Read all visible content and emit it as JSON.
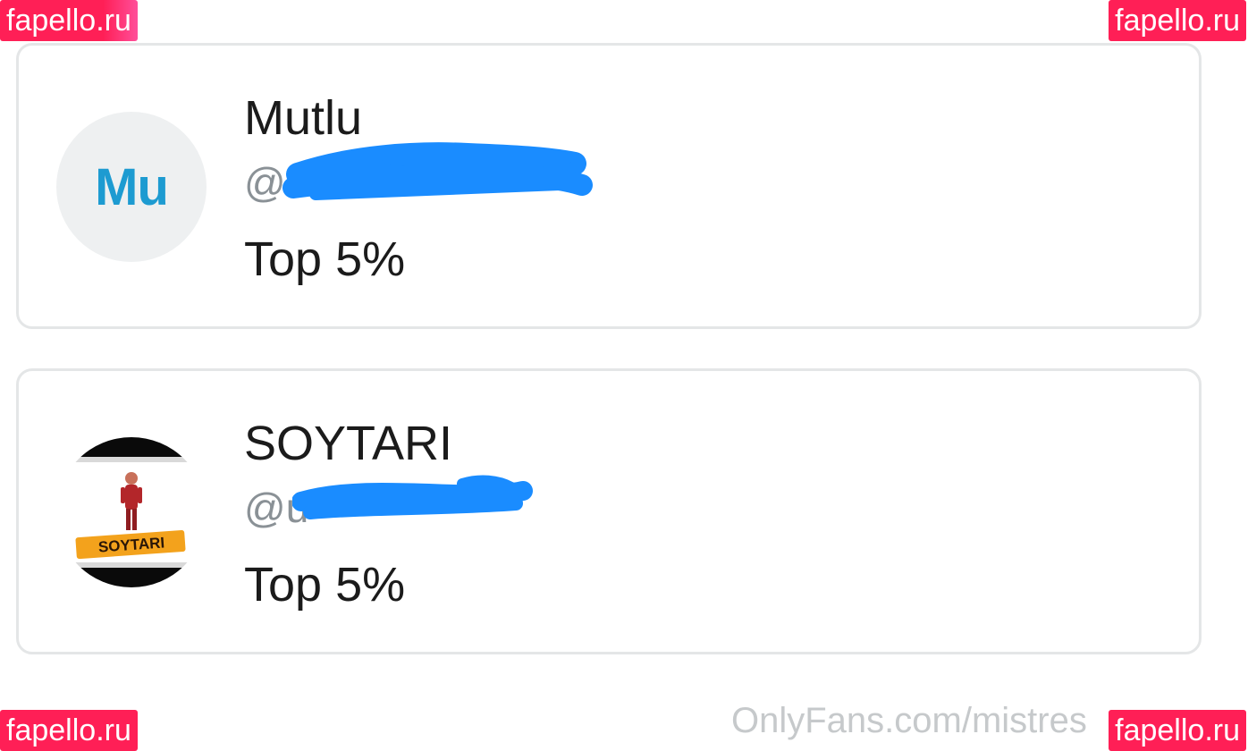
{
  "watermarks": {
    "top_left": "fapello.ru",
    "top_right": "fapello.ru",
    "bottom_left": "fapello.ru",
    "bottom_right": "fapello.ru",
    "footer": "OnlyFans.com/mistres"
  },
  "fans": [
    {
      "name": "Mutlu",
      "handle": "@",
      "rank": "Top 5%",
      "avatar_initials": "Mu",
      "avatar_color": "#1d9bd1"
    },
    {
      "name": "SOYTARI",
      "handle": "@u",
      "rank": "Top 5%",
      "avatar_logo_text": "SOYTARI"
    }
  ],
  "colors": {
    "card_border": "#e4e6e7",
    "redaction": "#1a8cff",
    "watermark": "#ff1f56"
  }
}
